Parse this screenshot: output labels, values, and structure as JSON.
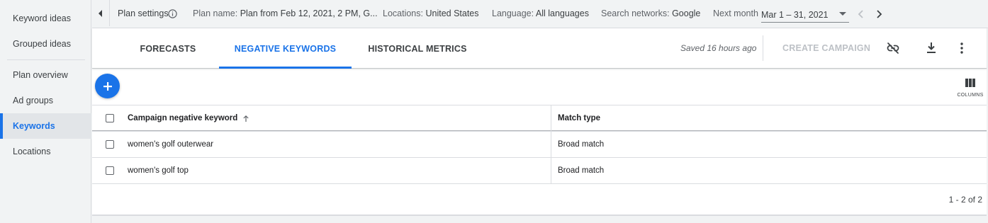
{
  "sidebar": {
    "items": [
      {
        "label": "Keyword ideas"
      },
      {
        "label": "Grouped ideas"
      },
      {
        "label": "Plan overview"
      },
      {
        "label": "Ad groups"
      },
      {
        "label": "Keywords"
      },
      {
        "label": "Locations"
      }
    ],
    "active": "Keywords"
  },
  "topbar": {
    "plan_settings": "Plan settings",
    "plan_name_label": "Plan name:",
    "plan_name_value": "Plan from Feb 12, 2021, 2 PM, G...",
    "locations_label": "Locations:",
    "locations_value": "United States",
    "language_label": "Language:",
    "language_value": "All languages",
    "networks_label": "Search networks:",
    "networks_value": "Google",
    "next_month": "Next month",
    "date_range": "Mar 1 – 31, 2021"
  },
  "tabs": [
    {
      "label": "FORECASTS"
    },
    {
      "label": "NEGATIVE KEYWORDS"
    },
    {
      "label": "HISTORICAL METRICS"
    }
  ],
  "active_tab": "NEGATIVE KEYWORDS",
  "toolbar": {
    "saved_status": "Saved 16 hours ago",
    "create_campaign": "CREATE CAMPAIGN",
    "columns_label": "COLUMNS"
  },
  "table": {
    "headers": [
      "Campaign negative keyword",
      "Match type"
    ],
    "rows": [
      {
        "keyword": "women's golf outerwear",
        "match_type": "Broad match"
      },
      {
        "keyword": "women's golf top",
        "match_type": "Broad match"
      }
    ],
    "pagination": "1 - 2 of 2"
  },
  "colors": {
    "accent": "#1a73e8",
    "sidebar_bg": "#f1f3f4",
    "disabled_text": "#bdc1c6"
  },
  "icons": [
    "chevron-left-icon",
    "info-icon",
    "dropdown-caret-icon",
    "chevron-left-icon",
    "chevron-right-icon",
    "link-off-icon",
    "download-icon",
    "more-vert-icon",
    "add-icon",
    "columns-icon",
    "sort-arrow-up-icon"
  ]
}
